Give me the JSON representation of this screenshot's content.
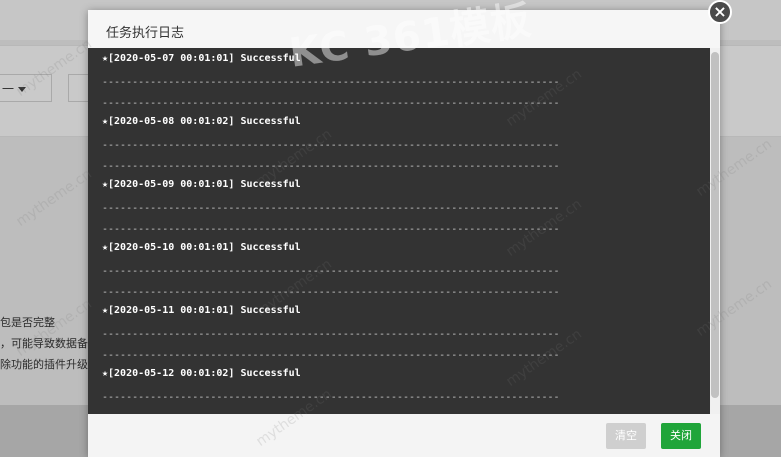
{
  "background": {
    "select_value": "一",
    "lines": [
      "包是否完整",
      "，可能导致数据备",
      "除功能的插件升级"
    ]
  },
  "modal": {
    "title": "任务执行日志",
    "close_icon": "×",
    "log_entries": [
      {
        "text": "★[2020-05-07 00:01:01] Successful"
      },
      {
        "text": "★[2020-05-08 00:01:02] Successful"
      },
      {
        "text": "★[2020-05-09 00:01:01] Successful"
      },
      {
        "text": "★[2020-05-10 00:01:01] Successful"
      },
      {
        "text": "★[2020-05-11 00:01:01] Successful"
      },
      {
        "text": "★[2020-05-12 00:01:02] Successful"
      }
    ],
    "separator": "----------------------------------------------------------------------------",
    "buttons": {
      "clear": "清空",
      "close": "关闭"
    }
  },
  "watermark": {
    "logo": "KC 361模板",
    "repeat": "mytheme.cn"
  },
  "colors": {
    "log_bg": "#333333",
    "primary_green": "#20a53a",
    "disabled_gray": "#cfcfcf"
  }
}
